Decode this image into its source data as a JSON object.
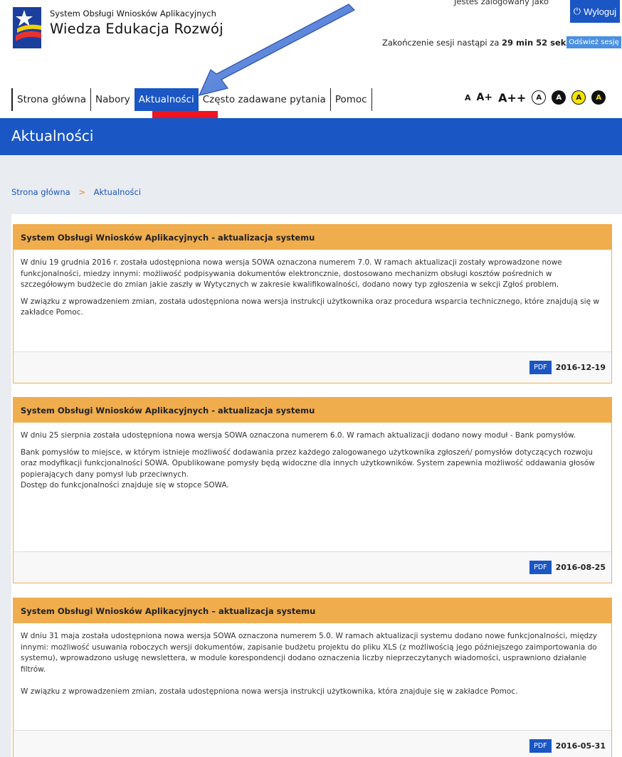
{
  "header": {
    "system_name": "System Obsługi Wniosków Aplikacyjnych",
    "program_name": "Wiedza Edukacja Rozwój",
    "logged_in_text": "Jesteś zalogowany jako",
    "logout_label": "Wyloguj",
    "session_prefix": "Zakończenie sesji nastąpi za",
    "session_time": "29 min 52 sek",
    "refresh_label": "Odśwież sesję"
  },
  "nav": {
    "items": [
      {
        "label": "Strona główna"
      },
      {
        "label": "Nabory"
      },
      {
        "label": "Aktualności"
      },
      {
        "label": "Często zadawane pytania"
      },
      {
        "label": "Pomoc"
      }
    ],
    "active_index": 2
  },
  "accessibility": {
    "font_normal": "A",
    "font_large": "A+",
    "font_xlarge": "A++",
    "contrast_labels": [
      "A",
      "A",
      "A",
      "A"
    ]
  },
  "page_title": "Aktualności",
  "breadcrumb": {
    "home": "Strona główna",
    "separator": ">",
    "current": "Aktualności"
  },
  "news": [
    {
      "title": "System Obsługi Wniosków Aplikacyjnych - aktualizacja systemu",
      "paragraphs": [
        "W dniu 19 grudnia 2016 r. została udostępniona nowa wersja SOWA oznaczona numerem 7.0. W ramach aktualizacji zostały wprowadzone nowe funkcjonalności, miedzy innymi: możliwość podpisywania dokumentów elektroncznie, dostosowano mechanizm obsługi kosztów pośrednich w szczegółowym budżecie do zmian jakie zaszły w Wytycznych w zakresie kwalifikowalności, dodano nowy typ zgłoszenia w sekcji Zgłoś problem.",
        "W związku z wprowadzeniem zmian, została udostępniona nowa wersja instrukcji użytkownika oraz procedura wsparcia technicznego, które znajdują się w zakładce Pomoc."
      ],
      "pdf_label": "PDF",
      "date": "2016-12-19"
    },
    {
      "title": "System Obsługi Wniosków Aplikacyjnych - aktualizacja systemu",
      "paragraphs": [
        "W dniu 25 sierpnia została udostępniona nowa wersja SOWA oznaczona numerem 6.0. W ramach aktualizacji dodano nowy moduł - Bank pomysłów.",
        "Bank pomysłów to miejsce, w którym istnieje możliwość dodawania przez każdego zalogowanego użytkownika zgłoszeń/ pomysłów dotyczących rozwoju oraz modyfikacji funkcjonalności SOWA. Opublikowane pomysły będą widoczne dla innych użytkowników. System zapewnia możliwość oddawania głosów popierających dany pomysł lub przeciwnych.",
        "Dostęp do funkcjonalności znajduje się w stopce SOWA."
      ],
      "pdf_label": "PDF",
      "date": "2016-08-25"
    },
    {
      "title": "System Obsługi Wniosków Aplikacyjnych – aktualizacja systemu",
      "paragraphs": [
        "W dniu 31 maja została udostępniona nowa wersja SOWA oznaczona numerem 5.0. W ramach aktualizacji systemu dodano nowe funkcjonalności, między innymi: możliwość usuwania roboczych wersji dokumentów, zapisanie budżetu projektu do pliku XLS (z możliwością jego późniejszego zaimportowania do systemu), wprowadzono usługę newslettera, w module korespondencji dodano oznaczenia liczby nieprzeczytanych wiadomości, usprawniono działanie filtrów.",
        "W związku z wprowadzeniem zmian, została udostępniona nowa wersja instrukcji użytkownika, która znajduje się w zakładce Pomoc."
      ],
      "pdf_label": "PDF",
      "date": "2016-05-31"
    }
  ],
  "colors": {
    "brand_blue": "#1a56c4",
    "card_orange": "#f0ad4e",
    "highlight_red": "#f0141e",
    "arrow_blue": "#4a78d4"
  }
}
